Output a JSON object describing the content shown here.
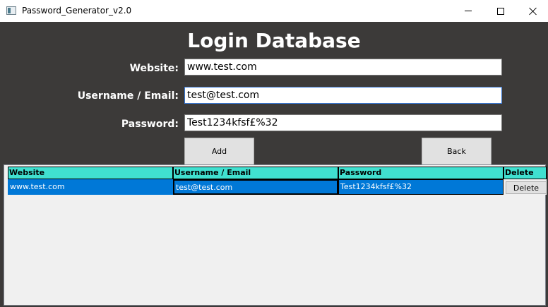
{
  "window": {
    "title": "Password_Generator_v2.0"
  },
  "page": {
    "heading": "Login Database"
  },
  "form": {
    "website_label": "Website:",
    "website_value": "www.test.com",
    "username_label": "Username / Email:",
    "username_value": "test@test.com",
    "password_label": "Password:",
    "password_value": "Test1234kfsf£%32",
    "add_label": "Add",
    "back_label": "Back"
  },
  "table": {
    "columns": [
      "Website",
      "Username / Email",
      "Password",
      "Delete"
    ],
    "rows": [
      {
        "website": "www.test.com",
        "username": "test@test.com",
        "password": "Test1234kfsf£%32",
        "delete_label": "Delete"
      }
    ]
  },
  "colors": {
    "background": "#3c3a39",
    "header": "#40e0d0",
    "selected_row": "#0078d7"
  }
}
